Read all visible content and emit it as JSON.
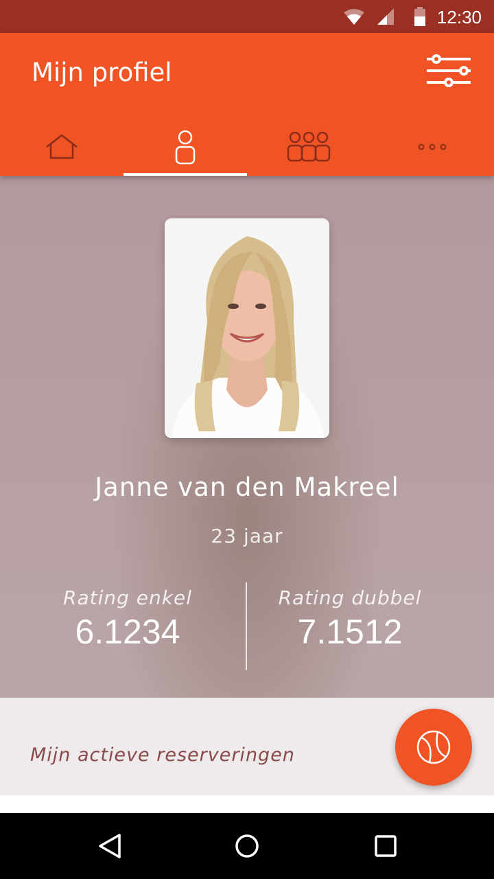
{
  "status_bar": {
    "time": "12:30",
    "icons": [
      "wifi-icon",
      "signal-icon",
      "battery-icon"
    ]
  },
  "app_bar": {
    "title": "Mijn profiel",
    "filter_icon": "sliders-icon",
    "color": "#f05425"
  },
  "tabs": [
    {
      "icon": "home-icon",
      "active": false
    },
    {
      "icon": "person-icon",
      "active": true
    },
    {
      "icon": "group-icon",
      "active": false
    },
    {
      "icon": "more-icon",
      "active": false
    }
  ],
  "profile": {
    "name": "Janne van den Makreel",
    "age": "23 jaar",
    "rating_single_label": "Rating enkel",
    "rating_single_value": "6.1234",
    "rating_double_label": "Rating dubbel",
    "rating_double_value": "7.1512"
  },
  "reservations": {
    "label": "Mijn actieve reserveringen"
  },
  "fab": {
    "icon": "tennis-ball-icon"
  },
  "nav": [
    "back-icon",
    "home-circle-icon",
    "recents-icon"
  ]
}
